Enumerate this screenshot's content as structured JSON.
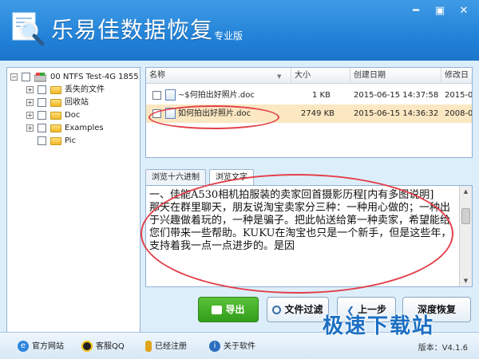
{
  "window": {
    "title": "乐易佳数据恢复",
    "edition": "专业版"
  },
  "tree": {
    "root": {
      "label": "00  NTFS  Test-4G  1855"
    },
    "items": [
      {
        "label": "丢失的文件"
      },
      {
        "label": "回收站"
      },
      {
        "label": "Doc"
      },
      {
        "label": "Examples"
      },
      {
        "label": "Pic"
      }
    ]
  },
  "filelist": {
    "columns": [
      "名称",
      "大小",
      "创建日期",
      "修改日"
    ],
    "rows": [
      {
        "name": "~$何拍出好照片.doc",
        "size": "1 KB",
        "created": "2015-06-15  14:37:58",
        "modified": "2015-06"
      },
      {
        "name": "如何拍出好照片.doc",
        "size": "2749 KB",
        "created": "2015-06-15  14:36:32",
        "modified": "2008-0"
      }
    ]
  },
  "tabs": [
    "浏览十六进制",
    "浏览文字"
  ],
  "preview": {
    "text": "一、佳能A530相机拍服装的卖家回首摄影历程[内有多图说明]\n那天在群里聊天，朋友说淘宝卖家分三种：一种用心做的；一种出于兴趣做着玩的，一种是骗子。把此帖送给第一种卖家，希望能给您们带来一些帮助。KUKU在淘宝也只是一个新手，但是这些年，支持着我一点一点进步的。是因"
  },
  "buttons": {
    "export": "导出",
    "filter": "文件过滤",
    "prev": "上一步",
    "deep": "深度恢复"
  },
  "statusbar": {
    "site": "官方网站",
    "qq": "客服QQ",
    "registered": "已经注册",
    "about": "关于软件",
    "version_label": "版本：",
    "version": "V4.1.6"
  },
  "watermark": "极速下载站",
  "colors": {
    "titlebar": "#1f7fd6",
    "export_button": "#3aa824",
    "highlight_row": "#fbe7c1",
    "annotation": "#e2414b"
  }
}
